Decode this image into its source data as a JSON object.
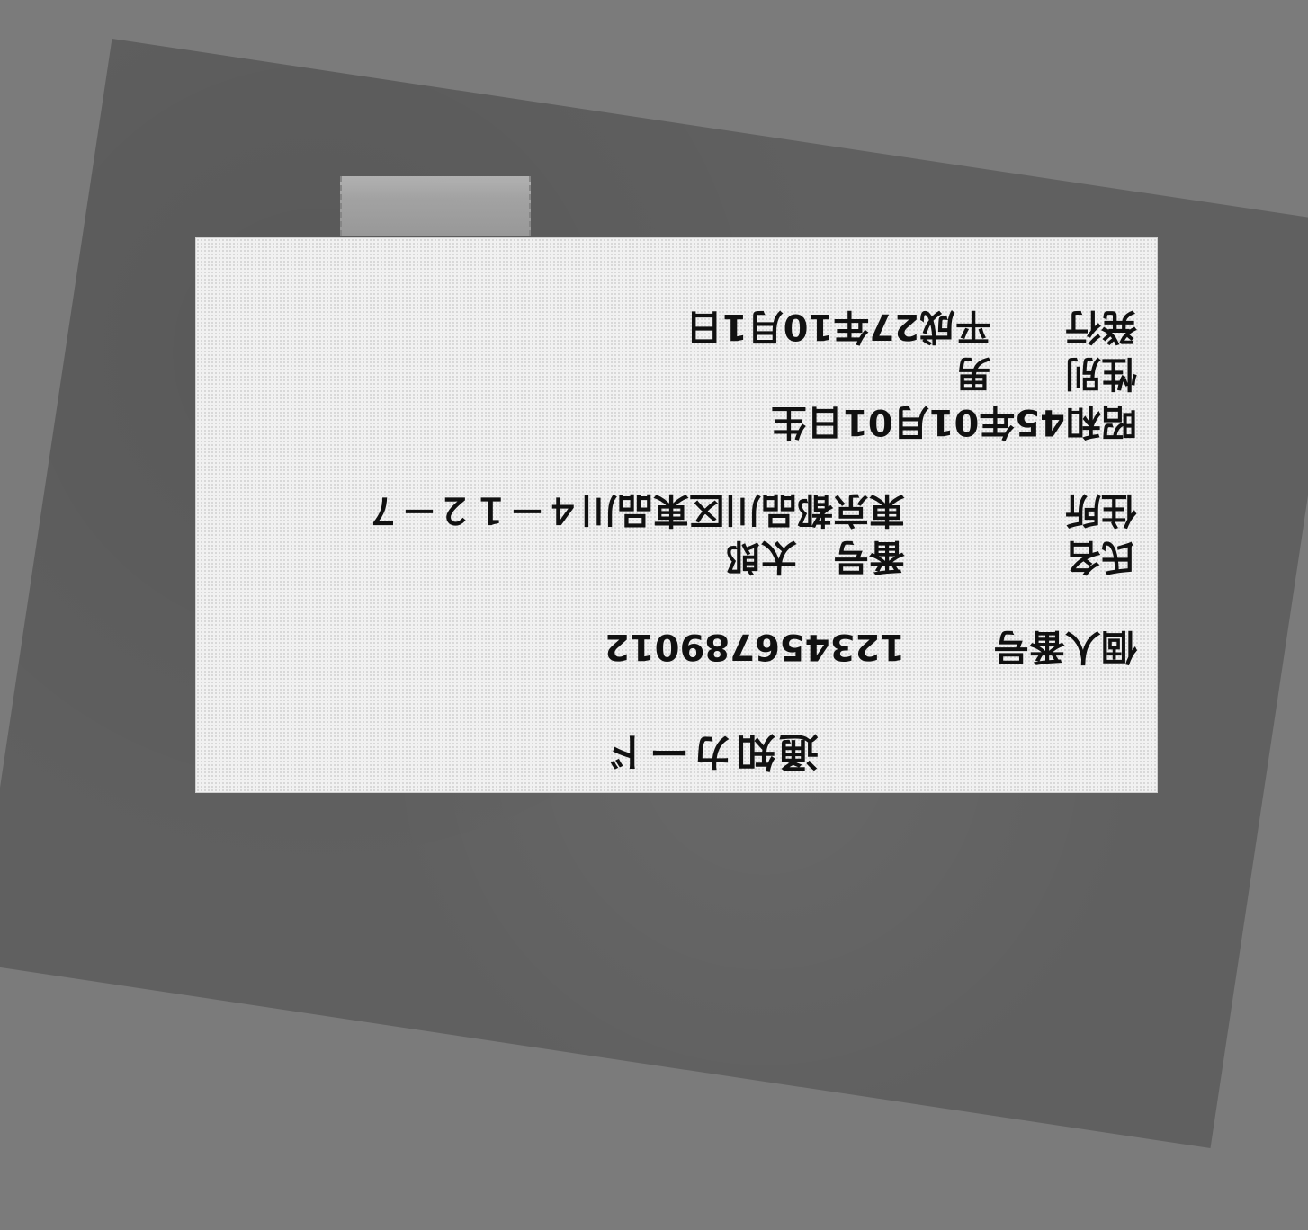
{
  "card": {
    "title": "通知カード",
    "number_label": "個人番号",
    "number_value": "123456789012",
    "name_label": "氏名",
    "name_value": "番号　太郎",
    "address_label": "住所",
    "address_value": "東京都品川区東品川４－１２－７",
    "birth": "昭和45年01月01日生",
    "gender_label": "性別",
    "gender_value": "男",
    "issue_label": "発行",
    "issue_value": "平成27年10月1日"
  }
}
